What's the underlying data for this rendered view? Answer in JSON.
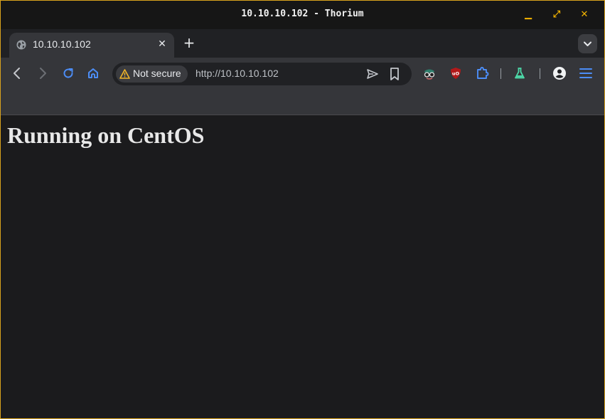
{
  "window": {
    "title": "10.10.10.102 - Thorium",
    "controls": {
      "minimize": "▁",
      "maximize": "⤢",
      "close": "✕"
    },
    "accent": "#f5b400"
  },
  "tabs": [
    {
      "title": "10.10.10.102",
      "icon": "globe-icon",
      "close": "✕"
    }
  ],
  "tabstrip": {
    "new_tab": "+"
  },
  "toolbar": {
    "security_label": "Not secure",
    "url": "http://10.10.10.102",
    "icons": [
      "back-icon",
      "forward-icon",
      "reload-icon",
      "home-icon",
      "send-icon",
      "bookmark-icon",
      "spy-extension-icon",
      "ublock-icon",
      "extensions-icon",
      "labs-icon",
      "profile-icon",
      "menu-icon"
    ]
  },
  "page": {
    "heading": "Running on CentOS"
  },
  "colors": {
    "link_blue": "#4c8df6",
    "warning": "#f0b429",
    "labs": "#4dd9a8",
    "ublock_red": "#b3191a"
  }
}
